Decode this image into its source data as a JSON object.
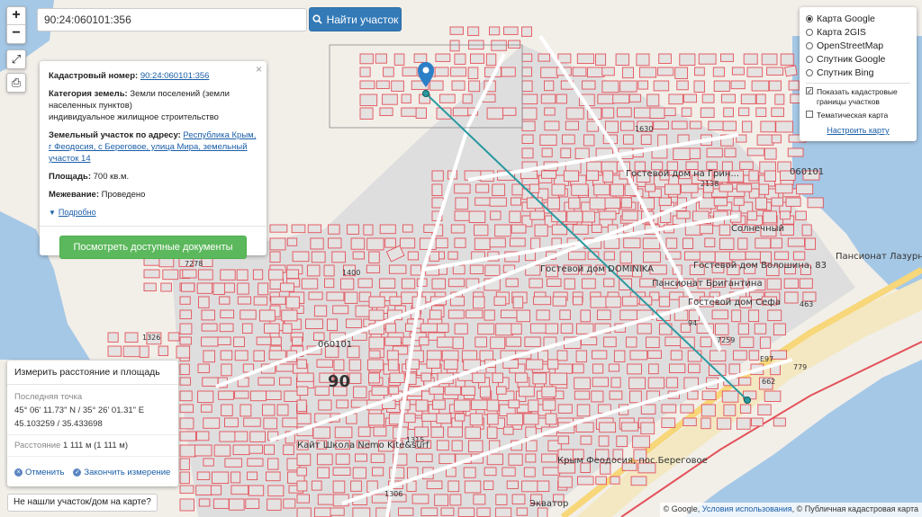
{
  "search": {
    "value": "90:24:060101:356",
    "button_label": "Найти участок"
  },
  "zoom": {
    "in": "+",
    "out": "−"
  },
  "info": {
    "cadastral_label": "Кадастровый номер:",
    "cadastral_value": "90:24:060101:356",
    "category_label": "Категория земель:",
    "category_value": "Земли поселений (земли населенных пунктов)",
    "usage_value": "индивидуальное жилищное строительство",
    "address_label": "Земельный участок по адресу:",
    "address_value": "Республика Крым, г Феодосия, с Береговое, улица Мира, земельный участок 14",
    "area_label": "Площадь:",
    "area_value": "700 кв.м.",
    "survey_label": "Межевание:",
    "survey_value": "Проведено",
    "more_label": "Подробно",
    "docs_button": "Посмотреть доступные документы",
    "close": "×"
  },
  "layers": {
    "options": [
      {
        "label": "Карта Google",
        "selected": true
      },
      {
        "label": "Карта 2GIS",
        "selected": false
      },
      {
        "label": "OpenStreetMap",
        "selected": false
      },
      {
        "label": "Спутник Google",
        "selected": false
      },
      {
        "label": "Спутник Bing",
        "selected": false
      }
    ],
    "show_cadastral": "Показать кадастровые границы участков",
    "show_cadastral_checked": true,
    "thematic": "Тематическая карта",
    "thematic_checked": false,
    "configure": "Настроить карту"
  },
  "measure": {
    "title": "Измерить расстояние и площадь",
    "last_point_label": "Последняя точка",
    "dms": "45° 06' 11.73\" N / 35° 26' 01.31\" E",
    "decimal": "45.103259 / 35.433698",
    "distance_label": "Расстояние",
    "distance_value": "1 111 м (1 111 м)",
    "cancel": "Отменить",
    "finish": "Закончить измерение"
  },
  "not_found": "Не нашли участок/дом на карте?",
  "attribution": {
    "google": "© Google",
    "terms": "Условия использования",
    "pkk": "© Публичная кадастровая карта"
  },
  "map_labels": {
    "quarter_top": "060101",
    "quarter_mid": "060101",
    "big_90": "90",
    "hotel1": "Гостевой дом на Грин...",
    "hotel2": "Солнечный",
    "hotel3": "Пансионат Лазурный берег",
    "hotel4": "Гостевой дом Волошина, 83",
    "hotel5": "Пансионат Бригантина",
    "hotel6": "Гостевой дом Сефа",
    "hotel7": "Гостевой дом DOMINIKA",
    "kite": "Кайт Школа Nemo Kite&surf",
    "crimea": "Крым Феодосия, пос.Береговое",
    "ekvator": "Экватор",
    "road": "Е97",
    "num_7278": "7278",
    "num_1326": "1326",
    "num_1315": "1315",
    "num_1306": "1306",
    "num_463": "463",
    "num_94": "94",
    "num_7259": "7259",
    "num_1400": "1400",
    "num_1630": "1630",
    "num_2138": "2138",
    "num_662": "662",
    "num_779": "779"
  },
  "colors": {
    "water": "#a5c8e6",
    "land": "#f2efe9",
    "parcel_fill": "#dededf",
    "parcel_stroke": "#e3525a",
    "road": "#ffffff",
    "highway": "#f7d77a",
    "measure_line": "#2a9aa0",
    "marker": "#2b7fc7"
  }
}
